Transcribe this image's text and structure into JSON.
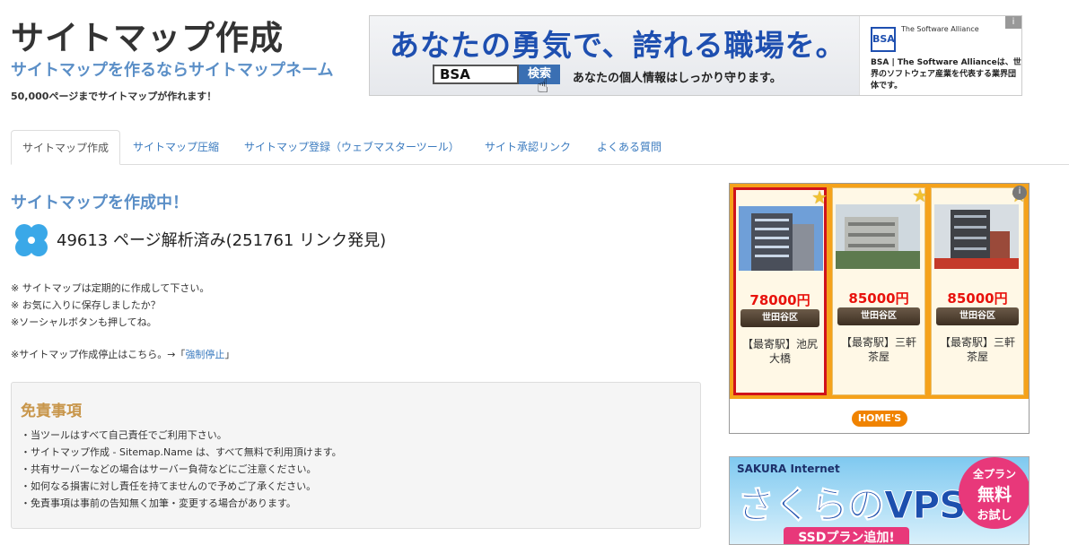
{
  "header": {
    "title": "サイトマップ作成",
    "tagline": "サイトマップを作るならサイトマップネーム",
    "subtitle": "50,000ページまでサイトマップが作れます！"
  },
  "top_banner": {
    "headline": "あなたの勇気で、誇れる職場を。",
    "search_value": "BSA",
    "search_button": "検索",
    "privacy_text": "あなたの個人情報はしっかり守ります。",
    "logo_text": "BSA",
    "brand_small": "The Software Alliance",
    "description": "BSA | The Software Allianceは、世界のソフトウェア産業を代表する業界団体です。",
    "info_icon": "i"
  },
  "tabs": [
    {
      "label": "サイトマップ作成",
      "active": true
    },
    {
      "label": "サイトマップ圧縮"
    },
    {
      "label": "サイトマップ登録（ウェブマスターツール）"
    },
    {
      "label": "サイト承認リンク"
    },
    {
      "label": "よくある質問"
    }
  ],
  "main": {
    "section_title": "サイトマップを作成中！",
    "pages_analyzed": "49613",
    "pages_text": "ページ解析済み(251761",
    "links_text": "リンク発見)",
    "notes": [
      "※ サイトマップは定期的に作成して下さい。",
      "※ お気に入りに保存しましたか？",
      "※ソーシャルボタンも押してね。"
    ],
    "stop_prefix": "※サイトマップ作成停止はこちら。→「",
    "stop_link": "強制停止",
    "stop_suffix": "」"
  },
  "disclaimer": {
    "title": "免責事項",
    "items": [
      "・当ツールはすべて自己責任でご利用下さい。",
      "・サイトマップ作成 - Sitemap.Name は、すべて無料で利用頂けます。",
      "・共有サーバーなどの場合はサーバー負荷などにご注意ください。",
      "・如何なる損害に対し責任を持てませんので予めご了承ください。",
      "・免責事項は事前の告知無く加筆・変更する場合があります。"
    ]
  },
  "homes_ad": {
    "listings": [
      {
        "price": "78000円",
        "area": "世田谷区",
        "station_1": "【最寄駅】池尻",
        "station_2": "大橋"
      },
      {
        "price": "85000円",
        "area": "世田谷区",
        "station_1": "【最寄駅】三軒",
        "station_2": "茶屋"
      },
      {
        "price": "85000円",
        "area": "世田谷区",
        "station_1": "【最寄駅】三軒",
        "station_2": "茶屋"
      }
    ],
    "logo": "HOME'S",
    "info_icon": "i"
  },
  "sakura_ad": {
    "brand": "SAKURA Internet",
    "title": "さくらのVPS",
    "badge_1": "全プラン",
    "badge_2": "無料",
    "badge_3": "お試し",
    "ribbon": "SSDプラン追加!"
  },
  "colors": {
    "accent_blue": "#5b8fc7",
    "link_blue": "#3b7bbf",
    "disclaimer_title": "#c8964b",
    "price_red": "#e8120c",
    "homes_orange": "#f5a21b"
  }
}
